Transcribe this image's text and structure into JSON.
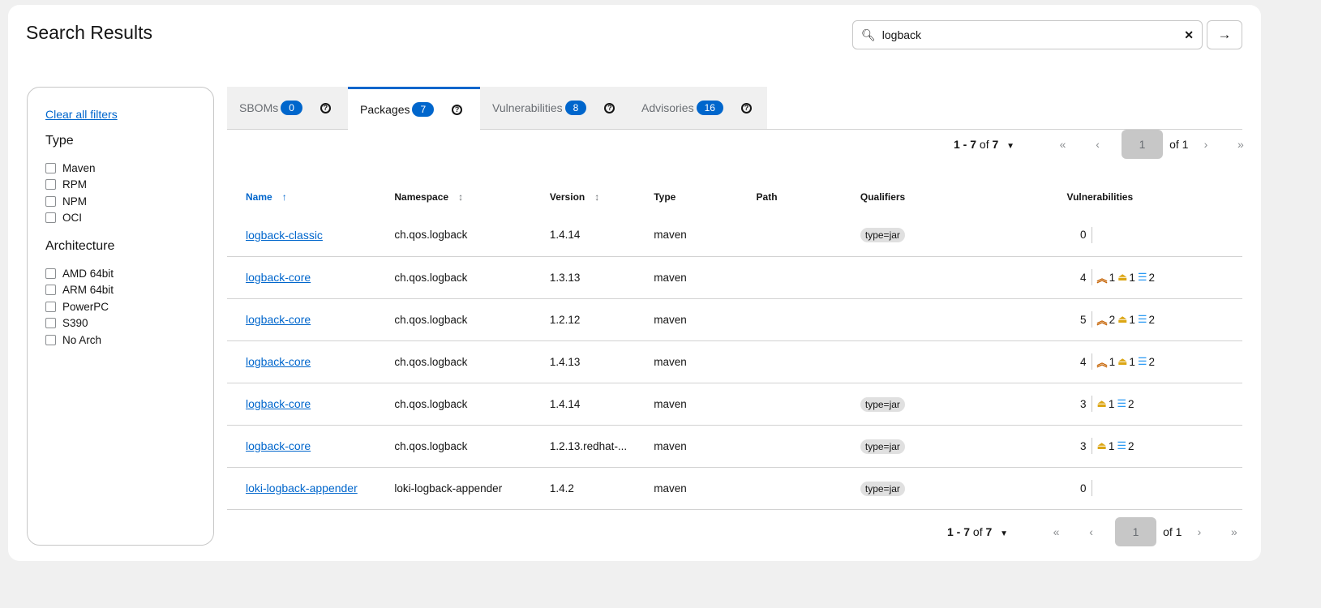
{
  "page": {
    "title": "Search Results"
  },
  "search": {
    "value": "logback",
    "clear": "✕",
    "go": "→"
  },
  "filters": {
    "clear_all": "Clear all filters",
    "type_heading": "Type",
    "types": [
      "Maven",
      "RPM",
      "NPM",
      "OCI"
    ],
    "arch_heading": "Architecture",
    "archs": [
      "AMD 64bit",
      "ARM 64bit",
      "PowerPC",
      "S390",
      "No Arch"
    ]
  },
  "tabs": [
    {
      "label": "SBOMs",
      "count": "0"
    },
    {
      "label": "Packages",
      "count": "7"
    },
    {
      "label": "Vulnerabilities",
      "count": "8"
    },
    {
      "label": "Advisories",
      "count": "16"
    }
  ],
  "pagination": {
    "range": "1 - 7",
    "of_label": "of",
    "total": "7",
    "page": "1",
    "of_pages": "of 1"
  },
  "table": {
    "columns": [
      "Name",
      "Namespace",
      "Version",
      "Type",
      "Path",
      "Qualifiers",
      "Vulnerabilities"
    ],
    "rows": [
      {
        "name": "logback-classic",
        "namespace": "ch.qos.logback",
        "version": "1.4.14",
        "type": "maven",
        "path": "",
        "qualifiers": "type=jar",
        "total": "0",
        "high": "",
        "medium": "",
        "low": ""
      },
      {
        "name": "logback-core",
        "namespace": "ch.qos.logback",
        "version": "1.3.13",
        "type": "maven",
        "path": "",
        "qualifiers": "",
        "total": "4",
        "high": "1",
        "medium": "1",
        "low": "2"
      },
      {
        "name": "logback-core",
        "namespace": "ch.qos.logback",
        "version": "1.2.12",
        "type": "maven",
        "path": "",
        "qualifiers": "",
        "total": "5",
        "high": "2",
        "medium": "1",
        "low": "2"
      },
      {
        "name": "logback-core",
        "namespace": "ch.qos.logback",
        "version": "1.4.13",
        "type": "maven",
        "path": "",
        "qualifiers": "",
        "total": "4",
        "high": "1",
        "medium": "1",
        "low": "2"
      },
      {
        "name": "logback-core",
        "namespace": "ch.qos.logback",
        "version": "1.4.14",
        "type": "maven",
        "path": "",
        "qualifiers": "type=jar",
        "total": "3",
        "high": "",
        "medium": "1",
        "low": "2"
      },
      {
        "name": "logback-core",
        "namespace": "ch.qos.logback",
        "version": "1.2.13.redhat-...",
        "type": "maven",
        "path": "",
        "qualifiers": "type=jar",
        "total": "3",
        "high": "",
        "medium": "1",
        "low": "2"
      },
      {
        "name": "loki-logback-appender",
        "namespace": "loki-logback-appender",
        "version": "1.4.2",
        "type": "maven",
        "path": "",
        "qualifiers": "type=jar",
        "total": "0",
        "high": "",
        "medium": "",
        "low": ""
      }
    ]
  },
  "colors": {
    "accent": "#0066cc",
    "high": "#c46100",
    "medium": "#dca614",
    "low": "#2b9af3"
  }
}
